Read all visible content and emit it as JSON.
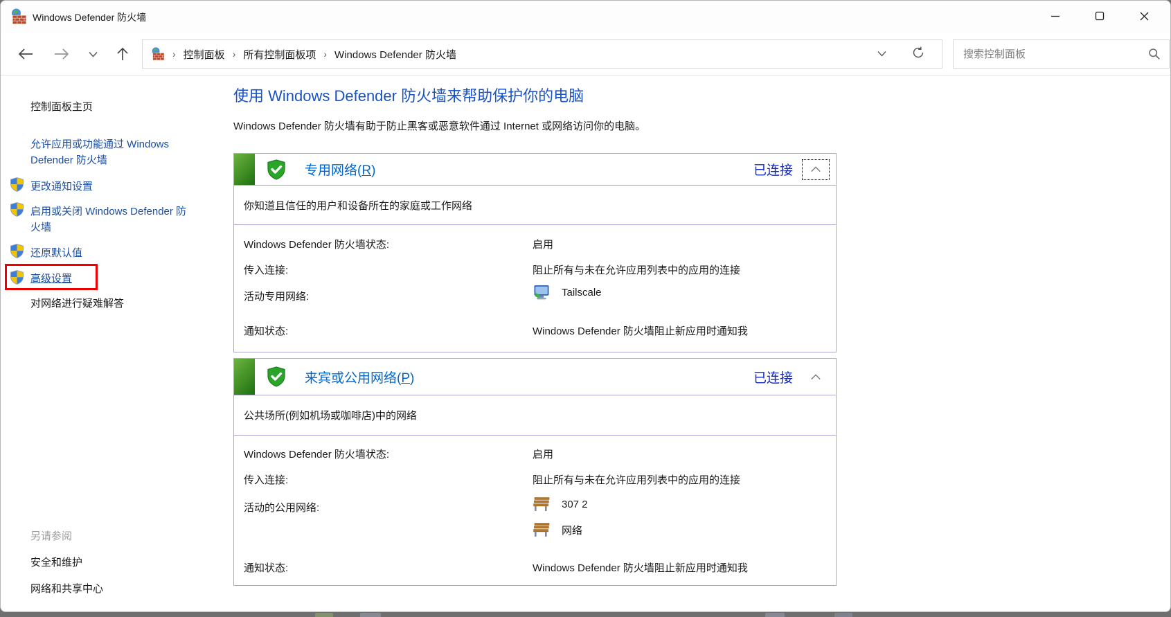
{
  "window": {
    "title": "Windows Defender 防火墙"
  },
  "titlebar": {
    "icons": {
      "app": "firewall-icon",
      "minimize": "minimize-icon",
      "maximize": "maximize-icon",
      "close": "close-icon"
    }
  },
  "nav": {
    "breadcrumb": [
      "控制面板",
      "所有控制面板项",
      "Windows Defender 防火墙"
    ],
    "separator": "›",
    "search_placeholder": "搜索控制面板",
    "icons": {
      "back": "arrow-left-icon",
      "forward": "arrow-right-icon",
      "recent": "chevron-down-icon",
      "up": "arrow-up-icon",
      "address_dropdown": "chevron-down-icon",
      "refresh": "refresh-icon",
      "search": "search-icon"
    }
  },
  "sidebar": {
    "home": "控制面板主页",
    "allow_apps": "允许应用或功能通过 Windows Defender 防火墙",
    "change_notify": "更改通知设置",
    "turn_on_off": "启用或关闭 Windows Defender 防火墙",
    "restore_defaults": "还原默认值",
    "advanced_settings": "高级设置",
    "troubleshoot": "对网络进行疑难解答",
    "see_also": "另请参阅",
    "security_maintenance": "安全和维护",
    "network_sharing_center": "网络和共享中心"
  },
  "main": {
    "title": "使用 Windows Defender 防火墙来帮助保护你的电脑",
    "description": "Windows Defender 防火墙有助于防止黑客或恶意软件通过 Internet 或网络访问你的电脑。"
  },
  "panels": [
    {
      "title_pre": "专用网络(",
      "access_key": "R",
      "title_post": ")",
      "status": "已连接",
      "description": "你知道且信任的用户和设备所在的家庭或工作网络",
      "state_label": "Windows Defender 防火墙状态:",
      "state_value": "启用",
      "inbound_label": "传入连接:",
      "inbound_value": "阻止所有与未在允许应用列表中的应用的连接",
      "active_label": "活动专用网络:",
      "networks": [
        "Tailscale"
      ],
      "notify_label": "通知状态:",
      "notify_value": "Windows Defender 防火墙阻止新应用时通知我"
    },
    {
      "title_pre": "来宾或公用网络(",
      "access_key": "P",
      "title_post": ")",
      "status": "已连接",
      "description": "公共场所(例如机场或咖啡店)中的网络",
      "state_label": "Windows Defender 防火墙状态:",
      "state_value": "启用",
      "inbound_label": "传入连接:",
      "inbound_value": "阻止所有与未在允许应用列表中的应用的连接",
      "active_label": "活动的公用网络:",
      "networks": [
        "307 2",
        "网络"
      ],
      "notify_label": "通知状态:",
      "notify_value": "Windows Defender 防火墙阻止新应用时通知我"
    }
  ],
  "colors": {
    "link_blue": "#0066cc",
    "status_blue": "#1228c0",
    "heading_blue": "#1a52c2",
    "panel_border": "#a8a8d0",
    "focus_red": "#ee0000",
    "shield_green": "#2aa52a"
  }
}
